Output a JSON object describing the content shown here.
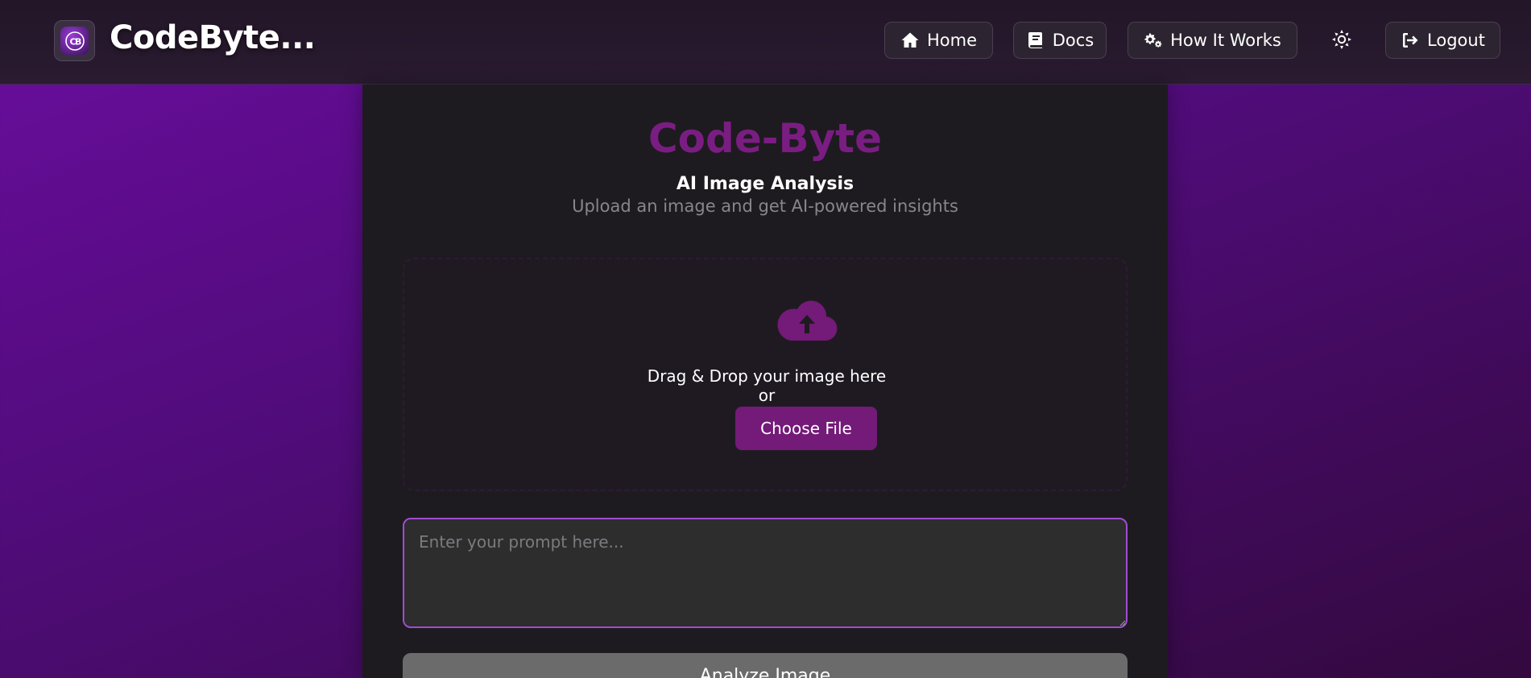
{
  "header": {
    "brand": "CodeByte...",
    "nav": [
      {
        "label": "Home",
        "icon": "home-icon"
      },
      {
        "label": "Docs",
        "icon": "book-icon"
      },
      {
        "label": "How It Works",
        "icon": "gears-icon"
      },
      {
        "label": "Logout",
        "icon": "logout-icon"
      }
    ],
    "theme_toggle_icon": "sun-icon"
  },
  "main": {
    "title": "Code-Byte",
    "subtitle": "AI Image Analysis",
    "tagline": "Upload an image and get AI-powered insights",
    "dropzone": {
      "icon": "cloud-upload-icon",
      "text": "Drag & Drop your image here",
      "or_text": "or",
      "choose_label": "Choose File"
    },
    "prompt": {
      "placeholder": "Enter your prompt here...",
      "value": ""
    },
    "analyze_label": "Analyze Image"
  },
  "colors": {
    "accent": "#741a78",
    "title": "#7a1d82",
    "focus_border": "#a14bd3",
    "background_gradient_start": "#6a0d9e",
    "background_gradient_end": "#33093f"
  }
}
